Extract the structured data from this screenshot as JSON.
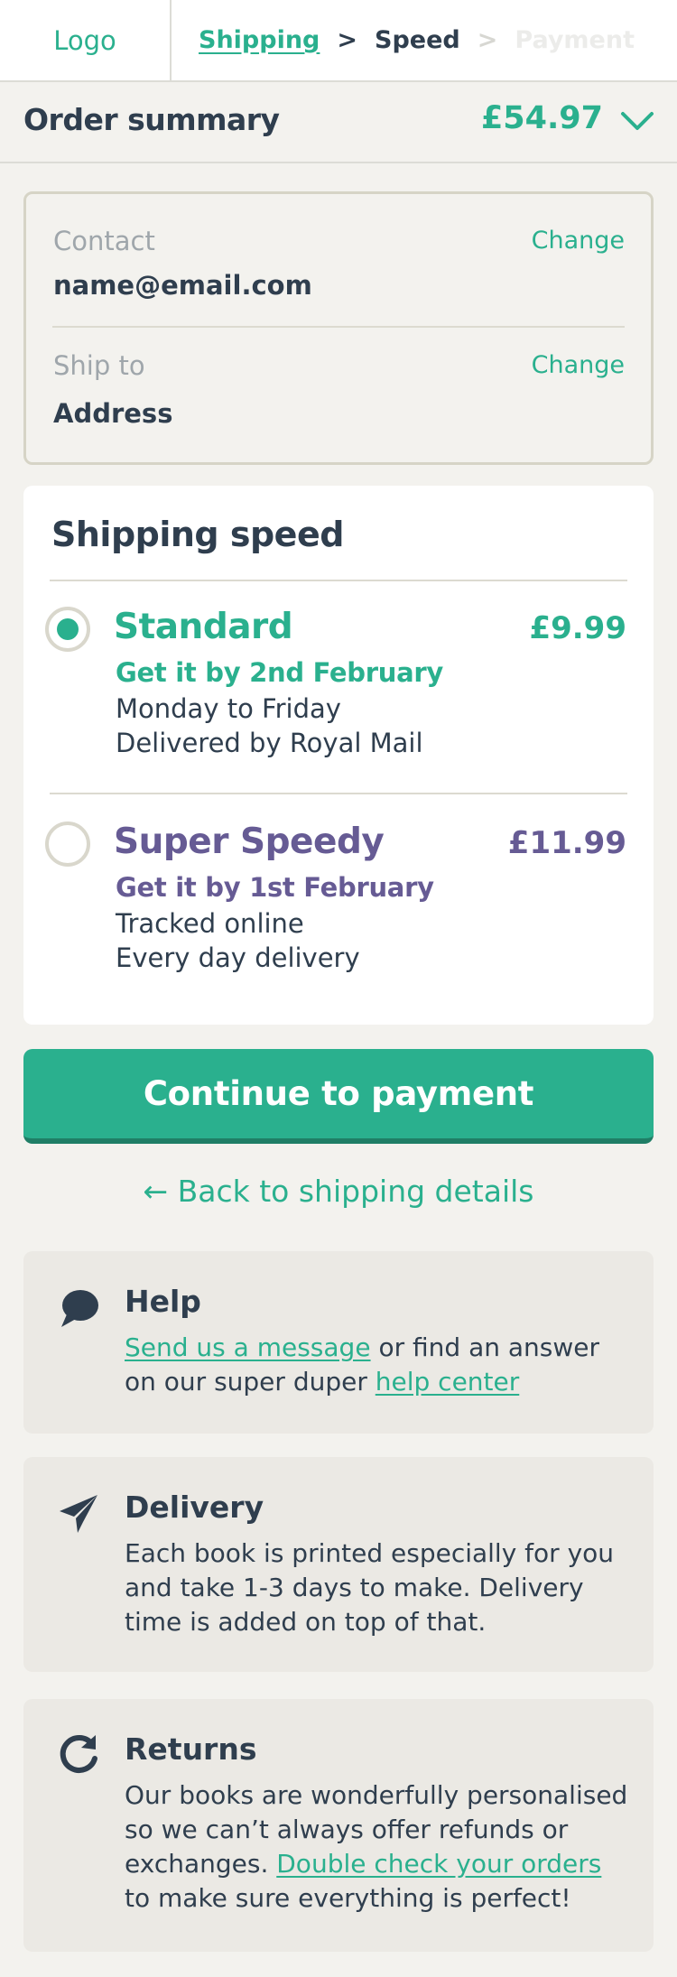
{
  "header": {
    "logo": "Logo",
    "breadcrumb": {
      "shipping": "Shipping",
      "sep1": ">",
      "speed": "Speed",
      "sep2": ">",
      "payment": "Payment"
    }
  },
  "summary": {
    "label": "Order summary",
    "total": "£54.97",
    "toggle_icon": "chevron-down-icon"
  },
  "contact": {
    "contact_label": "Contact",
    "contact_value": "name@email.com",
    "contact_change": "Change",
    "ship_label": "Ship to",
    "ship_value": "Address",
    "ship_change": "Change"
  },
  "shipping_speed": {
    "title": "Shipping speed",
    "options": [
      {
        "name": "Standard",
        "price": "£9.99",
        "eta": "Get it by 2nd February",
        "detail1": "Monday to Friday",
        "detail2": "Delivered by Royal Mail",
        "selected": true
      },
      {
        "name": "Super Speedy",
        "price": "£11.99",
        "eta": "Get it by 1st February",
        "detail1": "Tracked online",
        "detail2": "Every day delivery",
        "selected": false
      }
    ]
  },
  "actions": {
    "continue": "Continue to payment",
    "back": "← Back to shipping details"
  },
  "help": {
    "title": "Help",
    "link1": "Send us a message",
    "text1": " or find an answer",
    "text2": "on our super duper ",
    "link2": "help center",
    "icon": "chat-bubble-icon"
  },
  "delivery": {
    "title": "Delivery",
    "line1": "Each book is printed especially for you",
    "line2": "and take 1-3 days to make. Delivery",
    "line3": "time is added on top of that.",
    "icon": "paper-plane-icon"
  },
  "returns": {
    "title": "Returns",
    "line1": "Our books are wonderfully personalised",
    "line2": "so we can’t always offer refunds or",
    "line3_pre": "exchanges. ",
    "line3_link": "Double check your orders",
    "line4": "to make sure everything is perfect!",
    "icon": "refresh-icon"
  },
  "colors": {
    "accent": "#2ab08e",
    "purple": "#665b94",
    "text": "#2f3e4e",
    "background": "#f3f2ee"
  }
}
